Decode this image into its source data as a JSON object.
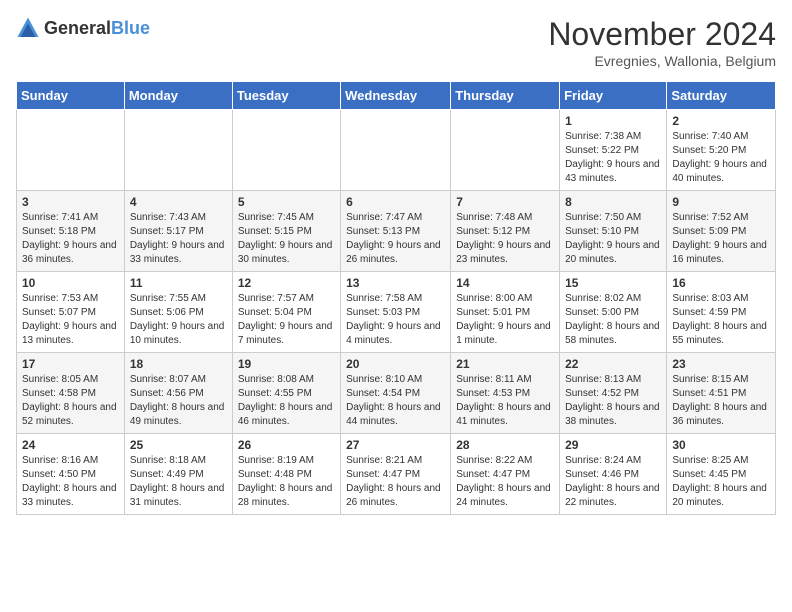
{
  "logo": {
    "general": "General",
    "blue": "Blue"
  },
  "title": "November 2024",
  "location": "Evregnies, Wallonia, Belgium",
  "weekdays": [
    "Sunday",
    "Monday",
    "Tuesday",
    "Wednesday",
    "Thursday",
    "Friday",
    "Saturday"
  ],
  "weeks": [
    [
      {
        "day": "",
        "info": ""
      },
      {
        "day": "",
        "info": ""
      },
      {
        "day": "",
        "info": ""
      },
      {
        "day": "",
        "info": ""
      },
      {
        "day": "",
        "info": ""
      },
      {
        "day": "1",
        "info": "Sunrise: 7:38 AM\nSunset: 5:22 PM\nDaylight: 9 hours and 43 minutes."
      },
      {
        "day": "2",
        "info": "Sunrise: 7:40 AM\nSunset: 5:20 PM\nDaylight: 9 hours and 40 minutes."
      }
    ],
    [
      {
        "day": "3",
        "info": "Sunrise: 7:41 AM\nSunset: 5:18 PM\nDaylight: 9 hours and 36 minutes."
      },
      {
        "day": "4",
        "info": "Sunrise: 7:43 AM\nSunset: 5:17 PM\nDaylight: 9 hours and 33 minutes."
      },
      {
        "day": "5",
        "info": "Sunrise: 7:45 AM\nSunset: 5:15 PM\nDaylight: 9 hours and 30 minutes."
      },
      {
        "day": "6",
        "info": "Sunrise: 7:47 AM\nSunset: 5:13 PM\nDaylight: 9 hours and 26 minutes."
      },
      {
        "day": "7",
        "info": "Sunrise: 7:48 AM\nSunset: 5:12 PM\nDaylight: 9 hours and 23 minutes."
      },
      {
        "day": "8",
        "info": "Sunrise: 7:50 AM\nSunset: 5:10 PM\nDaylight: 9 hours and 20 minutes."
      },
      {
        "day": "9",
        "info": "Sunrise: 7:52 AM\nSunset: 5:09 PM\nDaylight: 9 hours and 16 minutes."
      }
    ],
    [
      {
        "day": "10",
        "info": "Sunrise: 7:53 AM\nSunset: 5:07 PM\nDaylight: 9 hours and 13 minutes."
      },
      {
        "day": "11",
        "info": "Sunrise: 7:55 AM\nSunset: 5:06 PM\nDaylight: 9 hours and 10 minutes."
      },
      {
        "day": "12",
        "info": "Sunrise: 7:57 AM\nSunset: 5:04 PM\nDaylight: 9 hours and 7 minutes."
      },
      {
        "day": "13",
        "info": "Sunrise: 7:58 AM\nSunset: 5:03 PM\nDaylight: 9 hours and 4 minutes."
      },
      {
        "day": "14",
        "info": "Sunrise: 8:00 AM\nSunset: 5:01 PM\nDaylight: 9 hours and 1 minute."
      },
      {
        "day": "15",
        "info": "Sunrise: 8:02 AM\nSunset: 5:00 PM\nDaylight: 8 hours and 58 minutes."
      },
      {
        "day": "16",
        "info": "Sunrise: 8:03 AM\nSunset: 4:59 PM\nDaylight: 8 hours and 55 minutes."
      }
    ],
    [
      {
        "day": "17",
        "info": "Sunrise: 8:05 AM\nSunset: 4:58 PM\nDaylight: 8 hours and 52 minutes."
      },
      {
        "day": "18",
        "info": "Sunrise: 8:07 AM\nSunset: 4:56 PM\nDaylight: 8 hours and 49 minutes."
      },
      {
        "day": "19",
        "info": "Sunrise: 8:08 AM\nSunset: 4:55 PM\nDaylight: 8 hours and 46 minutes."
      },
      {
        "day": "20",
        "info": "Sunrise: 8:10 AM\nSunset: 4:54 PM\nDaylight: 8 hours and 44 minutes."
      },
      {
        "day": "21",
        "info": "Sunrise: 8:11 AM\nSunset: 4:53 PM\nDaylight: 8 hours and 41 minutes."
      },
      {
        "day": "22",
        "info": "Sunrise: 8:13 AM\nSunset: 4:52 PM\nDaylight: 8 hours and 38 minutes."
      },
      {
        "day": "23",
        "info": "Sunrise: 8:15 AM\nSunset: 4:51 PM\nDaylight: 8 hours and 36 minutes."
      }
    ],
    [
      {
        "day": "24",
        "info": "Sunrise: 8:16 AM\nSunset: 4:50 PM\nDaylight: 8 hours and 33 minutes."
      },
      {
        "day": "25",
        "info": "Sunrise: 8:18 AM\nSunset: 4:49 PM\nDaylight: 8 hours and 31 minutes."
      },
      {
        "day": "26",
        "info": "Sunrise: 8:19 AM\nSunset: 4:48 PM\nDaylight: 8 hours and 28 minutes."
      },
      {
        "day": "27",
        "info": "Sunrise: 8:21 AM\nSunset: 4:47 PM\nDaylight: 8 hours and 26 minutes."
      },
      {
        "day": "28",
        "info": "Sunrise: 8:22 AM\nSunset: 4:47 PM\nDaylight: 8 hours and 24 minutes."
      },
      {
        "day": "29",
        "info": "Sunrise: 8:24 AM\nSunset: 4:46 PM\nDaylight: 8 hours and 22 minutes."
      },
      {
        "day": "30",
        "info": "Sunrise: 8:25 AM\nSunset: 4:45 PM\nDaylight: 8 hours and 20 minutes."
      }
    ]
  ]
}
